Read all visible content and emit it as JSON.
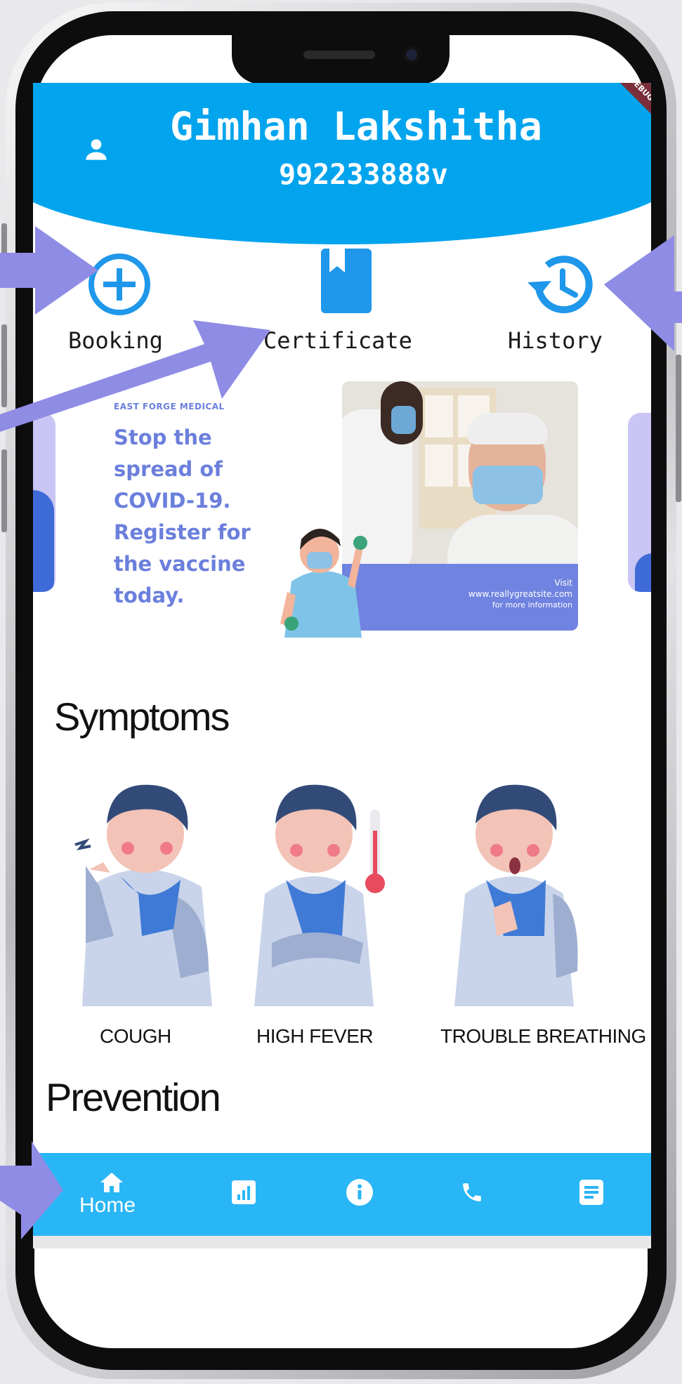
{
  "user": {
    "name": "Gimhan Lakshitha",
    "id_number": "992233888v"
  },
  "debug_banner": "DEBUG",
  "actions": [
    {
      "label": "Booking",
      "icon": "add-circle-icon"
    },
    {
      "label": "Certificate",
      "icon": "bookmark-book-icon"
    },
    {
      "label": "History",
      "icon": "history-clock-icon"
    }
  ],
  "banner": {
    "brand": "EAST FORGE MEDICAL",
    "lines": [
      "Stop the",
      "spread of",
      "COVID-19.",
      "Register for",
      "the vaccine",
      "today."
    ],
    "panel_visit": "Visit",
    "panel_site": "www.reallygreatsite.com",
    "panel_more": "for more information"
  },
  "symptoms": {
    "title": "Symptoms",
    "items": [
      {
        "label": "COUGH"
      },
      {
        "label": "HIGH FEVER"
      },
      {
        "label": "TROUBLE BREATHING"
      }
    ]
  },
  "prevention": {
    "title": "Prevention"
  },
  "bottom_nav": {
    "items": [
      {
        "icon": "home-icon",
        "label": "Home",
        "active": true
      },
      {
        "icon": "bar-chart-icon"
      },
      {
        "icon": "info-icon"
      },
      {
        "icon": "phone-icon"
      },
      {
        "icon": "document-icon"
      }
    ]
  },
  "colors": {
    "header": "#03a4ee",
    "nav": "#29b6f6",
    "accent_icon": "#1f97ea",
    "banner_text": "#6b7fdc",
    "annotation_arrow": "#8f8ce6"
  }
}
